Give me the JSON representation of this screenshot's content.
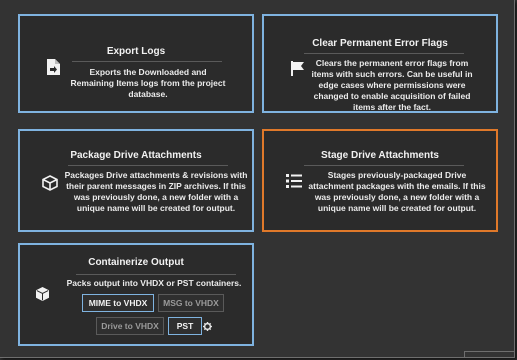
{
  "cards": {
    "export_logs": {
      "title": "Export Logs",
      "description": "Exports the Downloaded and Remaining Items logs from the project database.",
      "icon": "file-export-icon"
    },
    "clear_flags": {
      "title": "Clear Permanent Error Flags",
      "description": "Clears the permanent error flags from items with such errors. Can be useful in edge cases where permissions were changed to enable acquisition of failed items after the fact.",
      "icon": "flag-icon"
    },
    "package_attachments": {
      "title": "Package Drive Attachments",
      "description": "Packages Drive attachments & revisions with their parent messages in ZIP archives. If this was previously done, a new folder with a unique name will be created for output.",
      "icon": "package-icon"
    },
    "stage_attachments": {
      "title": "Stage Drive Attachments",
      "description": "Stages previously-packaged Drive attachment packages with the emails. If this was previously done, a new folder with a unique name will be created for output.",
      "icon": "list-icon"
    },
    "containerize": {
      "title": "Containerize Output",
      "description": "Packs output into VHDX or PST containers.",
      "icon": "cube-icon",
      "buttons": {
        "mime_vhdx": "MIME to VHDX",
        "msg_vhdx": "MSG to VHDX",
        "drive_vhdx": "Drive to VHDX",
        "pst": "PST"
      }
    }
  },
  "colors": {
    "card_border": "#7fb3e0",
    "selected_border": "#e0792a",
    "background": "#333333"
  }
}
